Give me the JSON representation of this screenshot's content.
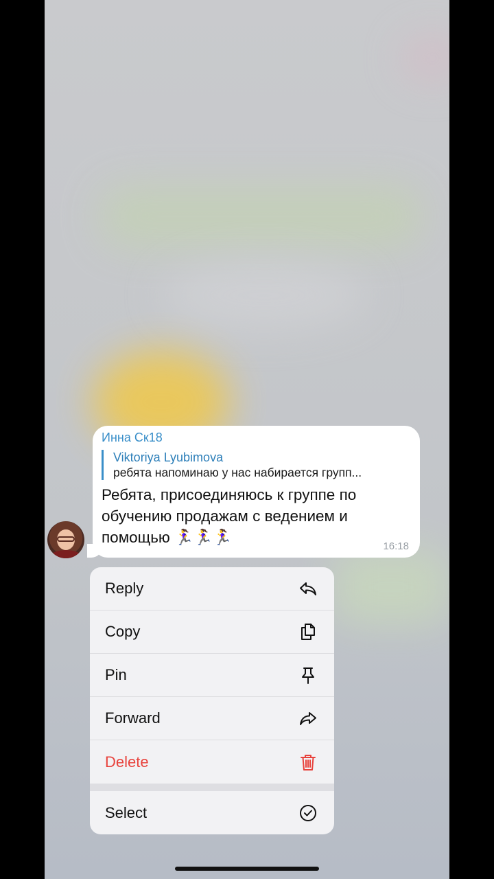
{
  "message": {
    "sender": "Инна Ск18",
    "reply": {
      "name": "Viktoriya Lyubimova",
      "text": "ребята напоминаю у нас набирается групп..."
    },
    "text": "Ребята, присоединяюсь к группе по обучению продажам с ведением и помощью 🏃‍♀️🏃‍♀️🏃‍♀️",
    "time": "16:18"
  },
  "context_menu": {
    "items": [
      {
        "label": "Reply",
        "icon": "reply-icon"
      },
      {
        "label": "Copy",
        "icon": "copy-icon"
      },
      {
        "label": "Pin",
        "icon": "pin-icon"
      },
      {
        "label": "Forward",
        "icon": "forward-icon"
      },
      {
        "label": "Delete",
        "icon": "trash-icon",
        "color": "#e8423c"
      },
      {
        "label": "Select",
        "icon": "check-circle-icon"
      }
    ]
  },
  "colors": {
    "accent": "#3a8fc9",
    "destructive": "#e8423c"
  }
}
